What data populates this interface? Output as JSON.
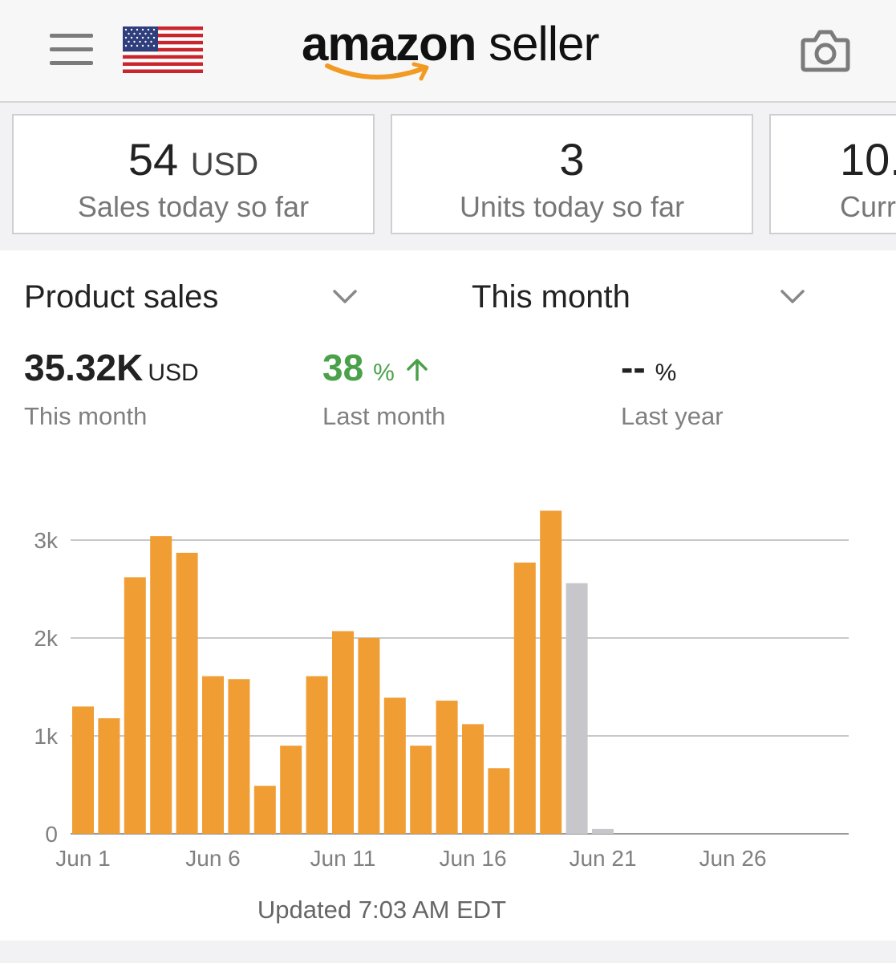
{
  "header": {
    "logo_brand": "amazon",
    "logo_product": "seller",
    "icons": [
      "menu-icon",
      "us-flag-icon",
      "amazon-smile-icon",
      "camera-icon"
    ]
  },
  "cards": [
    {
      "value": "54",
      "unit": "USD",
      "label": "Sales today so far"
    },
    {
      "value": "3",
      "unit": "",
      "label": "Units today so far"
    },
    {
      "value": "10.",
      "unit": "",
      "label": "Curr"
    }
  ],
  "selectors": {
    "metric": "Product sales",
    "period": "This month"
  },
  "stats": {
    "current": {
      "value": "35.32K",
      "unit": "USD",
      "label": "This month"
    },
    "last_month": {
      "value": "38",
      "unit": "%",
      "label": "Last month"
    },
    "last_year": {
      "value": "--",
      "unit": "%",
      "label": "Last year"
    }
  },
  "colors": {
    "bar": "#f09d34",
    "bar_projected": "#c7c7cb",
    "positive": "#4aa14a",
    "gridline": "#b5b5b5"
  },
  "chart_data": {
    "type": "bar",
    "ylim": [
      0,
      3000
    ],
    "yticks": [
      "0",
      "1k",
      "2k",
      "3k"
    ],
    "x_tick_labels": [
      "Jun 1",
      "Jun 6",
      "Jun 11",
      "Jun 16",
      "Jun 21",
      "Jun 26"
    ],
    "categories": [
      "Jun 1",
      "Jun 2",
      "Jun 3",
      "Jun 4",
      "Jun 5",
      "Jun 6",
      "Jun 7",
      "Jun 8",
      "Jun 9",
      "Jun 10",
      "Jun 11",
      "Jun 12",
      "Jun 13",
      "Jun 14",
      "Jun 15",
      "Jun 16",
      "Jun 17",
      "Jun 18",
      "Jun 19",
      "Jun 20",
      "Jun 21",
      "Jun 22",
      "Jun 23",
      "Jun 24",
      "Jun 25",
      "Jun 26",
      "Jun 27",
      "Jun 28",
      "Jun 29",
      "Jun 30"
    ],
    "values": [
      1300,
      1180,
      2620,
      3040,
      2870,
      1610,
      1580,
      490,
      900,
      1610,
      2070,
      2000,
      1390,
      900,
      1360,
      1120,
      670,
      2770,
      3300,
      2560,
      50
    ],
    "projected_from_index": 19
  },
  "footer": {
    "updated": "Updated 7:03 AM EDT"
  }
}
